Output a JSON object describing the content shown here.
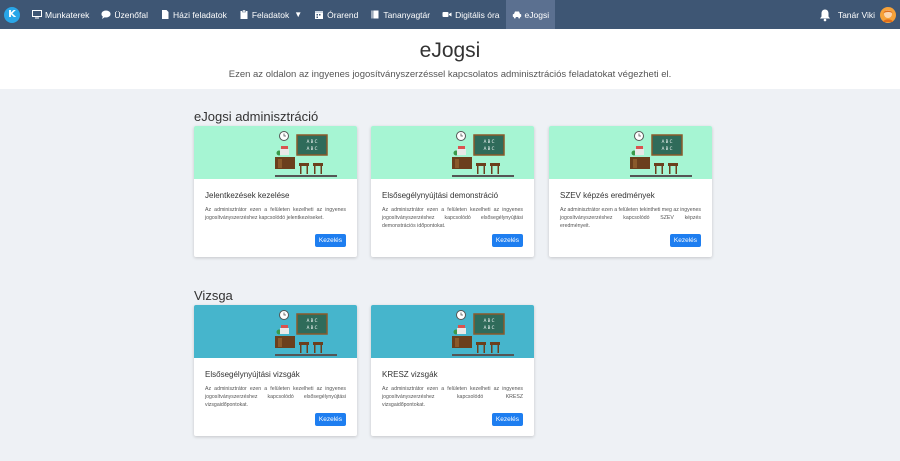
{
  "nav": {
    "logo_letter": "K",
    "items": [
      {
        "label": "Munkaterek",
        "icon": "monitor-icon"
      },
      {
        "label": "Üzenőfal",
        "icon": "chat-icon"
      },
      {
        "label": "Házi feladatok",
        "icon": "document-icon"
      },
      {
        "label": "Feladatok",
        "icon": "clipboard-icon",
        "caret": "▼"
      },
      {
        "label": "Órarend",
        "icon": "calendar-icon"
      },
      {
        "label": "Tananyagtár",
        "icon": "book-icon"
      },
      {
        "label": "Digitális óra",
        "icon": "video-icon"
      },
      {
        "label": "eJogsi",
        "icon": "car-icon"
      }
    ],
    "active": "eJogsi",
    "user_name": "Tanár Viki"
  },
  "header": {
    "title": "eJogsi",
    "subtitle": "Ezen az oldalon az ingyenes jogosítványszerzéssel kapcsolatos adminisztrációs feladatokat végezheti el."
  },
  "sections": [
    {
      "title": "eJogsi adminisztráció",
      "cards": [
        {
          "title": "Jelentkezések kezelése",
          "text": "Az adminisztrátor ezen a felületen kezelheti az ingyenes jogosítványszerzéshez kapcsolódó jelentkezéseket.",
          "button": "Kezelés"
        },
        {
          "title": "Elsősegélynyújtási demonstráció",
          "text": "Az adminisztrátor ezen a felületen kezelheti az ingyenes jogosítványszerzéshez kapcsolódó elsősegélynyújtási demonstrációs időpontokat.",
          "button": "Kezelés"
        },
        {
          "title": "SZEV képzés eredmények",
          "text": "Az adminisztrátor ezen a felületen tekintheti meg az ingyenes jogosítványszerzéshez kapcsolódó SZEV képzés eredményeit.",
          "button": "Kezelés"
        }
      ]
    },
    {
      "title": "Vizsga",
      "cards": [
        {
          "title": "Elsősegélynyújtási vizsgák",
          "text": "Az adminisztrátor ezen a felületen kezelheti az ingyenes jogosítványszerzéshez kapcsolódó elsősegélynyújtási vizsgaidőpontokat.",
          "button": "Kezelés"
        },
        {
          "title": "KRESZ vizsgák",
          "text": "Az adminisztrátor ezen a felületen kezelheti az ingyenes jogosítványszerzéshez kapcsolódó KRESZ vizsgaidőpontokat.",
          "button": "Kezelés"
        }
      ]
    }
  ],
  "illustration": {
    "board_text": "ABC ABC",
    "icon": "classroom-illustration-icon"
  },
  "colors": {
    "navbar": "#3e5674",
    "active_tab": "#5b7090",
    "button": "#1e7ef0",
    "card_mint": "#a6f5d3",
    "card_teal": "#46b5cc"
  }
}
